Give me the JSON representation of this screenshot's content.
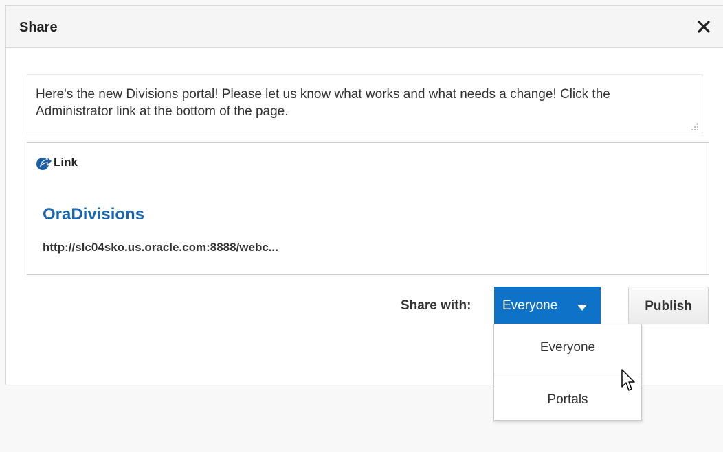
{
  "dialog": {
    "title": "Share",
    "close_icon": "close-icon"
  },
  "message": {
    "text": "Here's the new Divisions portal! Please let us know what works and what needs a change! Click the Administrator link at the bottom of the page."
  },
  "link_preview": {
    "icon": "share-arrow-icon",
    "label": "Link",
    "title": "OraDivisions",
    "url": "http://slc04sko.us.oracle.com:8888/webc..."
  },
  "share": {
    "label": "Share with:",
    "selected": "Everyone",
    "options": [
      "Everyone",
      "Portals"
    ]
  },
  "actions": {
    "publish_label": "Publish"
  },
  "colors": {
    "accent": "#0f72c9",
    "link": "#1a66b0"
  }
}
